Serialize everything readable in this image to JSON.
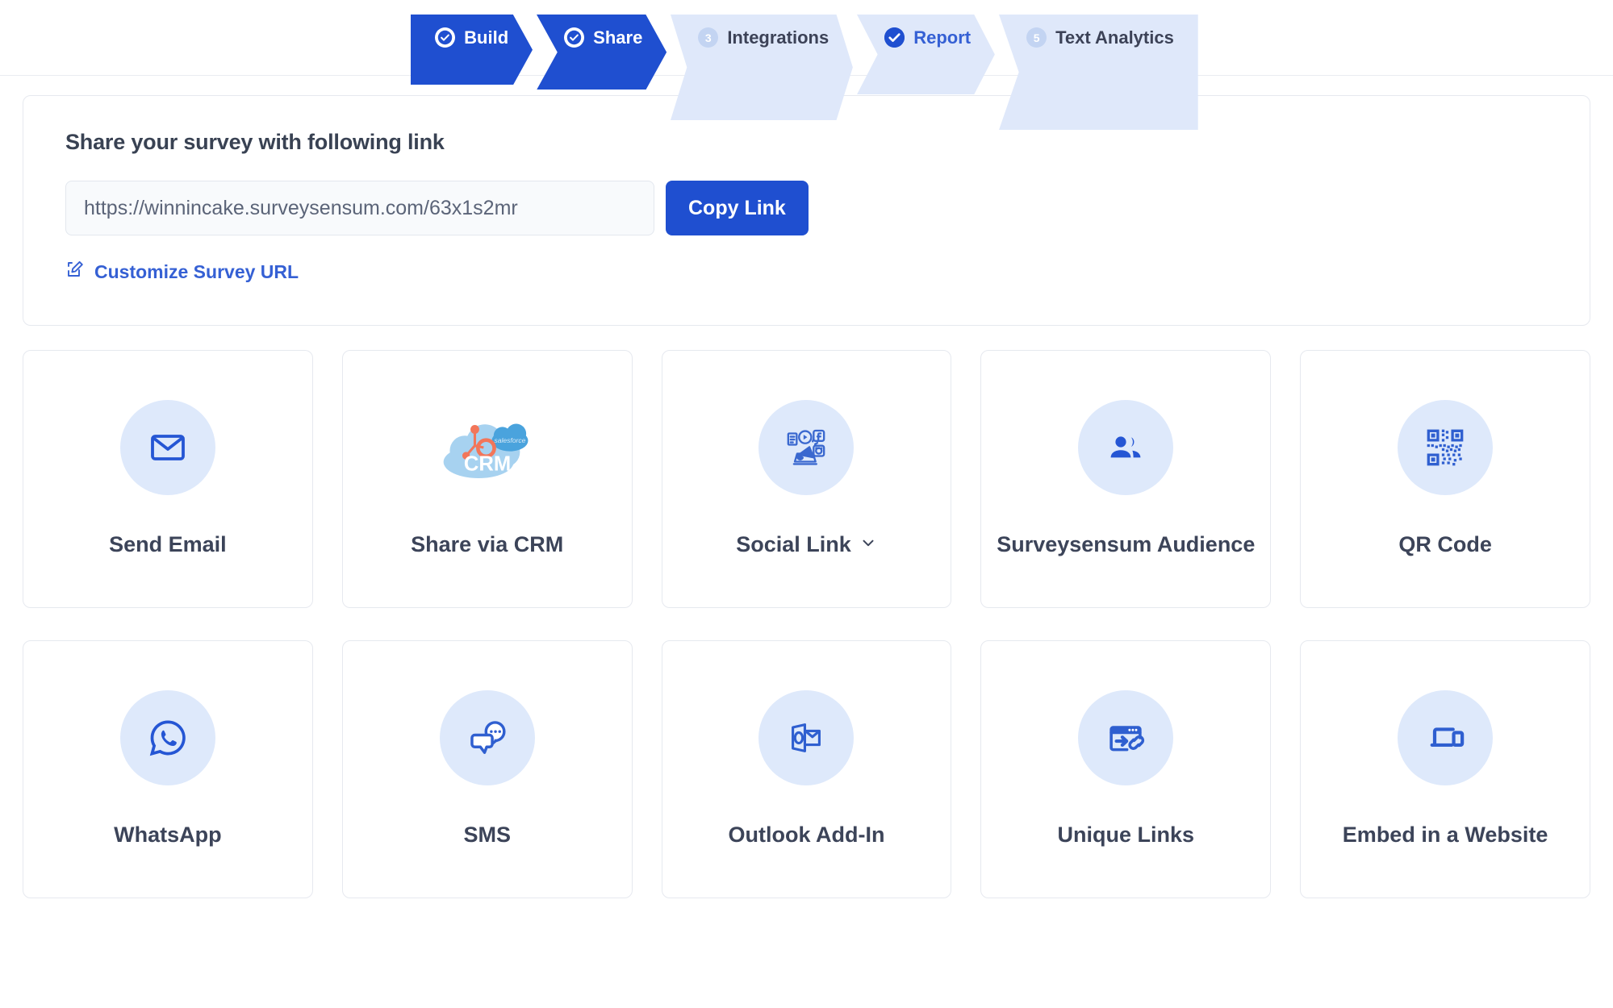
{
  "stepper": {
    "steps": [
      {
        "label": "Build",
        "state": "done",
        "icon": "check-icon",
        "number": "1"
      },
      {
        "label": "Share",
        "state": "done",
        "icon": "check-icon",
        "number": "2"
      },
      {
        "label": "Integrations",
        "state": "todo",
        "icon": "number",
        "number": "3"
      },
      {
        "label": "Report",
        "state": "link",
        "icon": "check-icon",
        "number": "4"
      },
      {
        "label": "Text Analytics",
        "state": "todo",
        "icon": "number",
        "number": "5"
      }
    ]
  },
  "share_link": {
    "heading": "Share your survey with following link",
    "url_value": "https://winnincake.surveysensum.com/63x1s2mr",
    "url_placeholder": "https://winnincake.surveysensum.com/63x1s2mr",
    "copy_label": "Copy Link",
    "customize_label": "Customize Survey URL",
    "customize_icon": "edit-square-icon"
  },
  "channels": {
    "row1": [
      {
        "label": "Send Email",
        "icon": "envelope-icon",
        "has_chevron": false
      },
      {
        "label": "Share via CRM",
        "icon": "crm-cloud-icon",
        "has_chevron": false
      },
      {
        "label": "Social Link",
        "icon": "megaphone-social-icon",
        "has_chevron": true
      },
      {
        "label": "Surveysensum Audience",
        "icon": "people-group-icon",
        "has_chevron": false
      },
      {
        "label": "QR Code",
        "icon": "qr-code-icon",
        "has_chevron": false
      }
    ],
    "row2": [
      {
        "label": "WhatsApp",
        "icon": "whatsapp-icon",
        "has_chevron": false
      },
      {
        "label": "SMS",
        "icon": "chat-bubbles-icon",
        "has_chevron": false
      },
      {
        "label": "Outlook Add-In",
        "icon": "outlook-icon",
        "has_chevron": false
      },
      {
        "label": "Unique Links",
        "icon": "browser-link-icon",
        "has_chevron": false
      },
      {
        "label": "Embed in a Website",
        "icon": "devices-icon",
        "has_chevron": false
      }
    ]
  },
  "crm_icon_text": {
    "cloud_label": "CRM",
    "salesforce_label": "salesforce"
  },
  "colors": {
    "primary_blue": "#1f4fd0",
    "link_blue": "#3560d4",
    "step_inactive_bg": "#dfe8fa",
    "icon_circle_bg": "#dee9fb",
    "text_dark": "#3c4459",
    "hubspot_orange": "#f2765a",
    "salesforce_blue": "#4aa3dd",
    "crm_cloud_blue": "#a7d2f0"
  }
}
